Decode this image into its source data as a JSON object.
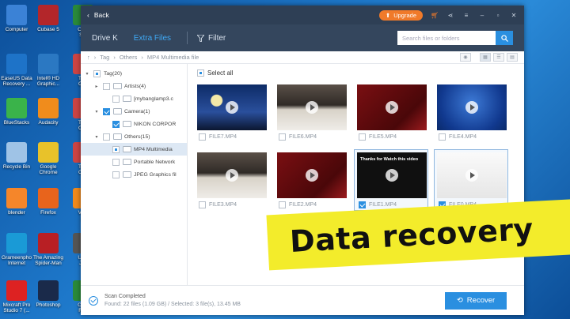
{
  "desktop": {
    "icons": [
      {
        "label": "Computer",
        "icon": "computer-icon",
        "color": "#3b82d6"
      },
      {
        "label": "Cubase 5",
        "icon": "cubase-icon",
        "color": "#b3262a"
      },
      {
        "label": "Cam\nStu",
        "icon": "camtasia-icon",
        "color": "#2a8a3a"
      },
      {
        "label": "EaseUS Data\nRecovery ...",
        "icon": "easeus-icon",
        "color": "#1e73c8"
      },
      {
        "label": "Intel® HD\nGraphic...",
        "icon": "intel-graphics-icon",
        "color": "#2b78c2"
      },
      {
        "label": "Tota\nCon",
        "icon": "total-converter-icon",
        "color": "#c44"
      },
      {
        "label": "BlueStacks",
        "icon": "bluestacks-icon",
        "color": "#3ab34a"
      },
      {
        "label": "Audacity",
        "icon": "audacity-icon",
        "color": "#f08c1c"
      },
      {
        "label": "Tota\nCon",
        "icon": "total-converter-icon",
        "color": "#c44"
      },
      {
        "label": "Recycle Bin",
        "icon": "recycle-bin-icon",
        "color": "#9fc3e6"
      },
      {
        "label": "Google\nChrome",
        "icon": "chrome-icon",
        "color": "#e8c22a"
      },
      {
        "label": "Tota\nCon",
        "icon": "total-converter-icon",
        "color": "#c44"
      },
      {
        "label": "blender",
        "icon": "blender-icon",
        "color": "#f5862a"
      },
      {
        "label": "Firefox",
        "icon": "firefox-icon",
        "color": "#e8641c"
      },
      {
        "label": "VLC\npl",
        "icon": "vlc-icon",
        "color": "#f08a1c"
      },
      {
        "label": "Grameenpho\nInternet",
        "icon": "grameenphone-icon",
        "color": "#1a9ad6"
      },
      {
        "label": "The Amazing\nSpider-Man",
        "icon": "spiderman-icon",
        "color": "#b81f24"
      },
      {
        "label": "USB\nJoy",
        "icon": "usb-icon",
        "color": "#555"
      },
      {
        "label": "Mixcraft Pro\nStudio 7 (...",
        "icon": "mixcraft-icon",
        "color": "#d22"
      },
      {
        "label": "Photoshop",
        "icon": "photoshop-icon",
        "color": "#1a2a4a"
      },
      {
        "label": "Cam\nRec",
        "icon": "camtasia-recorder-icon",
        "color": "#2a8a3a"
      }
    ]
  },
  "titlebar": {
    "back_label": "Back",
    "upgrade_label": "Upgrade"
  },
  "nav": {
    "drive": "Drive K",
    "extra_files": "Extra Files",
    "filter": "Filter",
    "search_placeholder": "Search files or folders"
  },
  "path": [
    "Tag",
    "Others",
    "MP4 Multimedia file"
  ],
  "tree": [
    {
      "label": "Tag(20)",
      "level": 0,
      "arrow": "▾",
      "check": "partial",
      "icon": false
    },
    {
      "label": "Artists(4)",
      "level": 1,
      "arrow": "▸",
      "check": "none",
      "icon": true
    },
    {
      "label": "[mybanglamp3.c",
      "level": 2,
      "arrow": "",
      "check": "none",
      "icon": true
    },
    {
      "label": "Camera(1)",
      "level": 1,
      "arrow": "▾",
      "check": "checked",
      "icon": true
    },
    {
      "label": "NIKON CORPOR",
      "level": 2,
      "arrow": "",
      "check": "checked",
      "icon": true
    },
    {
      "label": "Others(15)",
      "level": 1,
      "arrow": "▾",
      "check": "none",
      "icon": true
    },
    {
      "label": "MP4 Multimedia",
      "level": 2,
      "arrow": "",
      "check": "partial",
      "icon": true,
      "selected": true
    },
    {
      "label": "Portable Network",
      "level": 2,
      "arrow": "",
      "check": "none",
      "icon": true
    },
    {
      "label": "JPEG Graphics fil",
      "level": 2,
      "arrow": "",
      "check": "none",
      "icon": true
    }
  ],
  "select_all": "Select all",
  "files": [
    {
      "name": "FILE7.MP4",
      "thumb": "t-night",
      "checked": false
    },
    {
      "name": "FILE6.MP4",
      "thumb": "t-table",
      "checked": false
    },
    {
      "name": "FILE5.MP4",
      "thumb": "t-red",
      "checked": false
    },
    {
      "name": "FILE4.MP4",
      "thumb": "t-blue",
      "checked": false
    },
    {
      "name": "FILE3.MP4",
      "thumb": "t-table",
      "checked": false
    },
    {
      "name": "FILE2.MP4",
      "thumb": "t-red",
      "checked": false
    },
    {
      "name": "FILE1.MP4",
      "thumb": "t-black",
      "checked": true,
      "caption": "Thanks for Watch this video"
    },
    {
      "name": "FILE0.MP4",
      "thumb": "t-phone",
      "checked": true
    }
  ],
  "footer": {
    "status": "Scan Completed",
    "summary": "Found: 22 files (1.09 GB) / Selected: 3 file(s), 13.45 MB",
    "recover_label": "Recover"
  },
  "banner": {
    "text": "Data recovery",
    "color": "#f3ec2b"
  },
  "colors": {
    "accent": "#2a8fe0",
    "titlebar": "#2e3f55",
    "upgrade": "#f07a2a"
  }
}
